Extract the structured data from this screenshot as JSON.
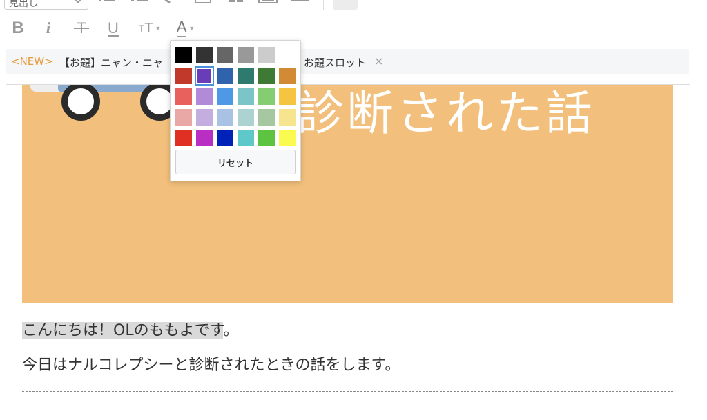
{
  "toolbar": {
    "heading_select": {
      "value": "見出し"
    },
    "format": {
      "bold_label": "B",
      "italic_label": "i",
      "strike_label": "T",
      "underline_label": "U",
      "size_small": "T",
      "size_large": "T",
      "color_label": "A"
    }
  },
  "category_bar": {
    "new_tag": "<NEW>",
    "topic_visible_start": "【お題】ニャン・ニャ",
    "topic_visible_end": "お題スロット",
    "close_glyph": "×"
  },
  "color_picker": {
    "swatches": [
      "#000000",
      "#333333",
      "#666666",
      "#999999",
      "#cccccc",
      "#ffffff",
      "#c0392b",
      "#6a3db8",
      "#2f64ad",
      "#2e7a6f",
      "#3f7a35",
      "#d28a35",
      "#e8615c",
      "#b18ad8",
      "#4f98e6",
      "#7bc4c8",
      "#85cd73",
      "#f5c441",
      "#e9a8a6",
      "#c4aee0",
      "#a9c1e3",
      "#acd3d2",
      "#a5c8a0",
      "#f7e48e",
      "#e03023",
      "#b92fc4",
      "#0022b8",
      "#5fc8c8",
      "#5cc440",
      "#fafa50"
    ],
    "selected_index": 7,
    "reset_label": "リセット"
  },
  "editor": {
    "banner": {
      "text": "診断された話",
      "background": "#f2c07c"
    },
    "paragraph_1_highlighted": "こんにちは！OLのももよです",
    "paragraph_1_rest": "。",
    "paragraph_2": "今日はナルコレプシーと診断されたときの話をします。"
  }
}
